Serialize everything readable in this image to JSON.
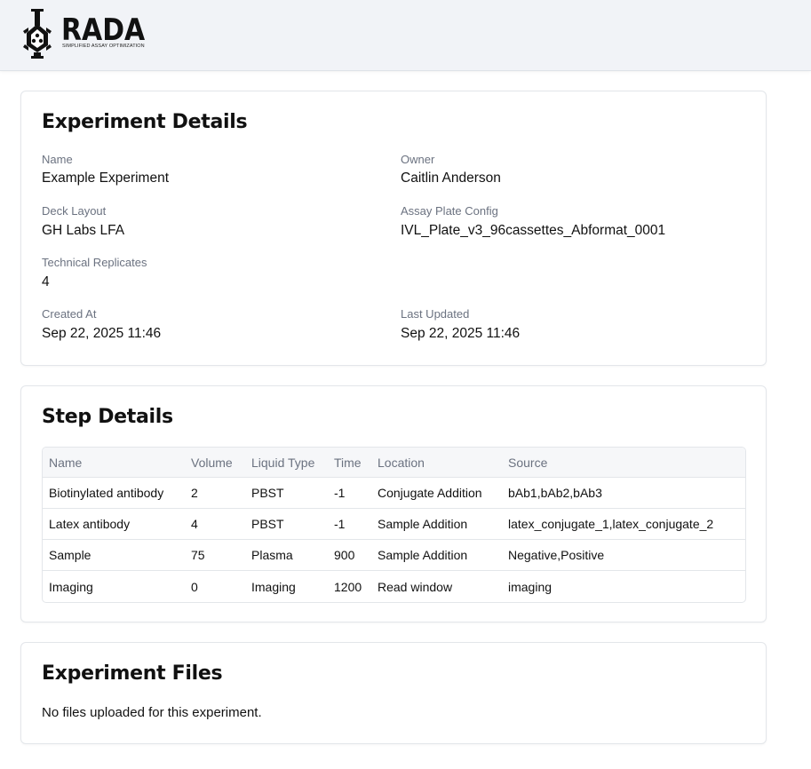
{
  "header": {
    "logo_text": "RADA",
    "logo_tagline": "SIMPLIFIED ASSAY OPTIMIZATION"
  },
  "experiment_details": {
    "title": "Experiment Details",
    "name_label": "Name",
    "name_value": "Example Experiment",
    "owner_label": "Owner",
    "owner_value": "Caitlin Anderson",
    "deck_layout_label": "Deck Layout",
    "deck_layout_value": "GH Labs LFA",
    "plate_config_label": "Assay Plate Config",
    "plate_config_value": "IVL_Plate_v3_96cassettes_Abformat_0001",
    "replicates_label": "Technical Replicates",
    "replicates_value": "4",
    "created_label": "Created At",
    "created_value": "Sep 22, 2025 11:46",
    "updated_label": "Last Updated",
    "updated_value": "Sep 22, 2025 11:46"
  },
  "step_details": {
    "title": "Step Details",
    "columns": [
      "Name",
      "Volume",
      "Liquid Type",
      "Time",
      "Location",
      "Source"
    ],
    "rows": [
      [
        "Biotinylated antibody",
        "2",
        "PBST",
        "-1",
        "Conjugate Addition",
        "bAb1,bAb2,bAb3"
      ],
      [
        "Latex antibody",
        "4",
        "PBST",
        "-1",
        "Sample Addition",
        "latex_conjugate_1,latex_conjugate_2"
      ],
      [
        "Sample",
        "75",
        "Plasma",
        "900",
        "Sample Addition",
        "Negative,Positive"
      ],
      [
        "Imaging",
        "0",
        "Imaging",
        "1200",
        "Read window",
        "imaging"
      ]
    ]
  },
  "experiment_files": {
    "title": "Experiment Files",
    "empty_message": "No files uploaded for this experiment."
  }
}
